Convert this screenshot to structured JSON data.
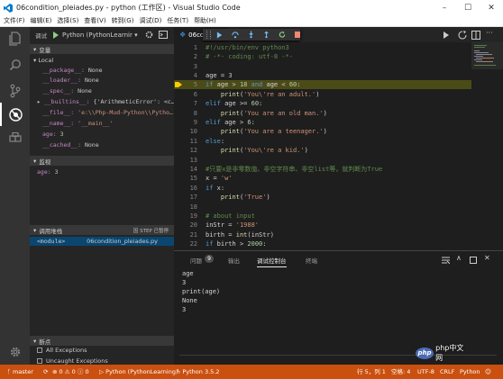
{
  "window": {
    "title": "06condition_pleiades.py - python (工作区) - Visual Studio Code",
    "controls": [
      "–",
      "☐",
      "✕"
    ]
  },
  "menu": [
    "文件(F)",
    "编辑(E)",
    "选择(S)",
    "查看(V)",
    "转到(G)",
    "调试(D)",
    "任务(T)",
    "帮助(H)"
  ],
  "debug_bar": {
    "label": "调试",
    "config": "Python (PythonLearnir ▾"
  },
  "variables": {
    "header": "变量",
    "local_label": "Local",
    "rows": [
      {
        "name": "__package__:",
        "value": "None"
      },
      {
        "name": "__loader__:",
        "value": "None"
      },
      {
        "name": "__spec__:",
        "value": "None"
      },
      {
        "name": "__builtins__:",
        "value": "{'ArithmeticError': <c…"
      },
      {
        "name": "__file__:",
        "value": "'e:\\\\Php-Mud-Python\\\\Pytho…"
      },
      {
        "name": "__name__:",
        "value": "'__main__'"
      },
      {
        "name": "age:",
        "value": "3"
      },
      {
        "name": "__cached__:",
        "value": "None"
      }
    ]
  },
  "watch": {
    "header": "监视",
    "expr_name": "age:",
    "expr_value": "3"
  },
  "callstack": {
    "header": "调用堆栈",
    "state": "因 STEP 已暂停",
    "frame": "<module>",
    "file": "06condition_pleiades.py"
  },
  "breakpoints": {
    "header": "断点",
    "items": [
      "All Exceptions",
      "Uncaught Exceptions"
    ]
  },
  "editor": {
    "tab_label": "06co",
    "lines": [
      {
        "n": "1",
        "code": "#!/usr/bin/env python3"
      },
      {
        "n": "2",
        "code": "# -*- coding: utf-8 -*-"
      },
      {
        "n": "3",
        "code": ""
      },
      {
        "n": "4",
        "code": "age = 3"
      },
      {
        "n": "5",
        "code": "if age > 18 and age < 60:"
      },
      {
        "n": "6",
        "code": "    print('You\\'re an adult.')"
      },
      {
        "n": "7",
        "code": "elif age >= 60:"
      },
      {
        "n": "8",
        "code": "    print('You are an old man.')"
      },
      {
        "n": "9",
        "code": "elif age > 6:"
      },
      {
        "n": "10",
        "code": "    print('You are a teenager.')"
      },
      {
        "n": "11",
        "code": "else:"
      },
      {
        "n": "12",
        "code": "    print('You\\'re a kid.')"
      },
      {
        "n": "13",
        "code": ""
      },
      {
        "n": "14",
        "code": "#只要x是非零数值、非空字符串、非空list等，就判断为True"
      },
      {
        "n": "15",
        "code": "x = 'w'"
      },
      {
        "n": "16",
        "code": "if x:"
      },
      {
        "n": "17",
        "code": "    print('True')"
      },
      {
        "n": "18",
        "code": ""
      },
      {
        "n": "19",
        "code": "# about input"
      },
      {
        "n": "20",
        "code": "inStr = '1988'"
      },
      {
        "n": "21",
        "code": "birth = int(inStr)"
      },
      {
        "n": "22",
        "code": "if birth > 2000:"
      }
    ]
  },
  "panel": {
    "tabs": [
      "问题",
      "输出",
      "调试控制台",
      "终端"
    ],
    "problems_count": "9",
    "output": [
      "age",
      "3",
      "print(age)",
      "None",
      "3"
    ]
  },
  "status": {
    "branch": "master",
    "errors": "0",
    "warnings": "0",
    "infos": "0",
    "debug_config": "Python (PythonLearning)",
    "interpreter": "Python 3.5.2",
    "position": "行 5，列 1",
    "spaces": "空格: 4",
    "encoding": "UTF-8",
    "eol": "CRLF",
    "language": "Python",
    "watermark": "php中文网"
  },
  "colors": {
    "statusbar": "#ca5010",
    "current_line": "#4b4b18",
    "breakpoint_arrow": "#ffcc00"
  }
}
